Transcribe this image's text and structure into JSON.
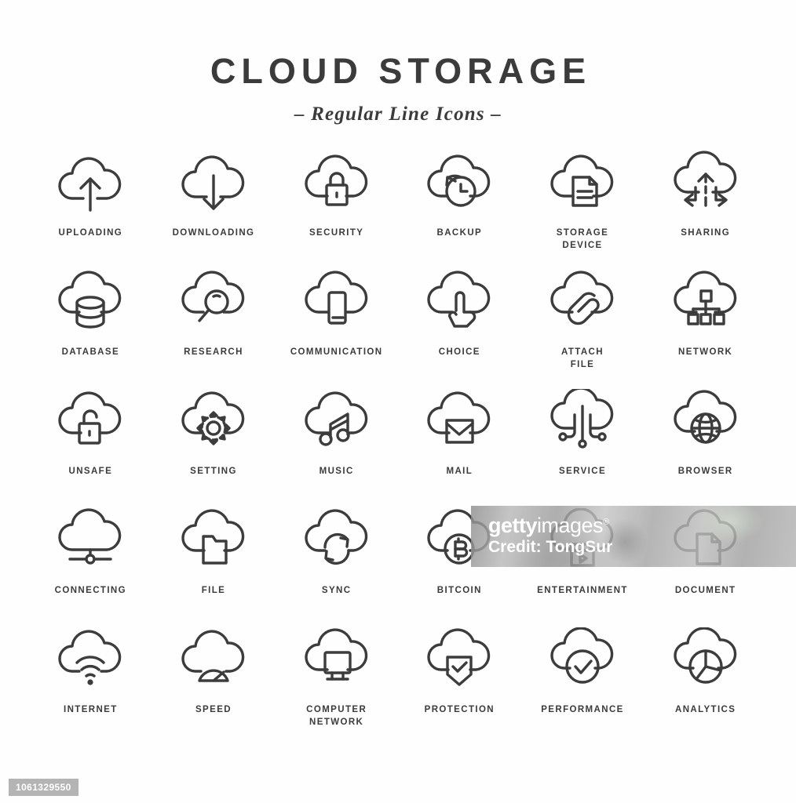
{
  "header": {
    "title": "CLOUD STORAGE",
    "subtitle": "– Regular Line Icons –"
  },
  "watermark": {
    "brand_bold": "getty",
    "brand_light": "images",
    "registered": "®",
    "credit": "Credit: TongSur"
  },
  "footer": {
    "image_id": "1061329550"
  },
  "colors": {
    "background": "#fefefe",
    "stroke": "#3c3c3c",
    "text": "#3b3b3b",
    "watermark_text": "#ffffff",
    "id_badge": "#b4b4b4"
  },
  "grid": {
    "columns": 6,
    "rows": 5,
    "icons": [
      {
        "icon": "cloud-upload-arrow-icon",
        "label": "UPLOADING"
      },
      {
        "icon": "cloud-download-arrow-icon",
        "label": "DOWNLOADING"
      },
      {
        "icon": "cloud-lock-closed-icon",
        "label": "SECURITY"
      },
      {
        "icon": "cloud-clock-restore-icon",
        "label": "BACKUP"
      },
      {
        "icon": "cloud-document-storage-icon",
        "label": "STORAGE\nDEVICE"
      },
      {
        "icon": "cloud-share-arrows-icon",
        "label": "SHARING"
      },
      {
        "icon": "cloud-database-cylinder-icon",
        "label": "DATABASE"
      },
      {
        "icon": "cloud-magnifier-icon",
        "label": "RESEARCH"
      },
      {
        "icon": "cloud-smartphone-icon",
        "label": "COMMUNICATION"
      },
      {
        "icon": "cloud-pointing-hand-icon",
        "label": "CHOICE"
      },
      {
        "icon": "cloud-paperclip-icon",
        "label": "ATTACH\nFILE"
      },
      {
        "icon": "cloud-network-tree-icon",
        "label": "NETWORK"
      },
      {
        "icon": "cloud-lock-open-icon",
        "label": "UNSAFE"
      },
      {
        "icon": "cloud-gear-icon",
        "label": "SETTING"
      },
      {
        "icon": "cloud-music-notes-icon",
        "label": "MUSIC"
      },
      {
        "icon": "cloud-envelope-icon",
        "label": "MAIL"
      },
      {
        "icon": "cloud-circuit-nodes-icon",
        "label": "SERVICE"
      },
      {
        "icon": "cloud-globe-icon",
        "label": "BROWSER"
      },
      {
        "icon": "cloud-connection-node-icon",
        "label": "CONNECTING"
      },
      {
        "icon": "cloud-folder-icon",
        "label": "FILE"
      },
      {
        "icon": "cloud-sync-arrows-icon",
        "label": "SYNC"
      },
      {
        "icon": "cloud-bitcoin-coin-icon",
        "label": "BITCOIN"
      },
      {
        "icon": "cloud-video-play-icon",
        "label": "ENTERTAINMENT"
      },
      {
        "icon": "cloud-file-page-icon",
        "label": "DOCUMENT"
      },
      {
        "icon": "cloud-wifi-signal-icon",
        "label": "INTERNET"
      },
      {
        "icon": "cloud-speedometer-icon",
        "label": "SPEED"
      },
      {
        "icon": "cloud-monitor-icon",
        "label": "COMPUTER\nNETWORK"
      },
      {
        "icon": "cloud-shield-check-icon",
        "label": "PROTECTION"
      },
      {
        "icon": "cloud-circle-check-icon",
        "label": "PERFORMANCE"
      },
      {
        "icon": "cloud-pie-chart-icon",
        "label": "ANALYTICS"
      }
    ]
  }
}
